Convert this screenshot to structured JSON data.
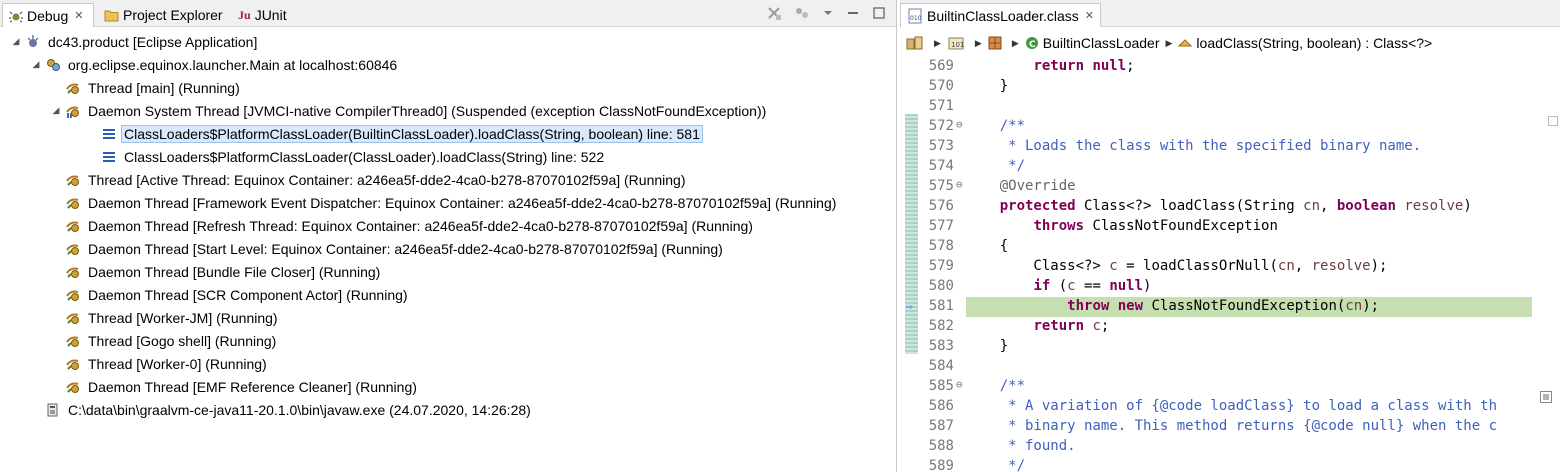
{
  "debug_view": {
    "tabs": [
      {
        "label": "Debug",
        "icon": "debug-icon",
        "active": true,
        "close": "✕"
      },
      {
        "label": "Project Explorer",
        "icon": "folder-icon",
        "active": false
      },
      {
        "label": "JUnit",
        "icon": "junit-icon",
        "active": false
      }
    ],
    "tree": [
      {
        "label": "dc43.product [Eclipse Application]",
        "icon": "launch-icon",
        "depth": 0,
        "expanded": true
      },
      {
        "label": "org.eclipse.equinox.launcher.Main at localhost:60846",
        "icon": "debug-target-icon",
        "depth": 1,
        "expanded": true
      },
      {
        "label": "Thread [main] (Running)",
        "icon": "thread-running-icon",
        "depth": 2
      },
      {
        "label": "Daemon System Thread [JVMCI-native CompilerThread0] (Suspended (exception ClassNotFoundException))",
        "icon": "thread-suspended-icon",
        "depth": 2,
        "expanded": true
      },
      {
        "label": "ClassLoaders$PlatformClassLoader(BuiltinClassLoader).loadClass(String, boolean) line: 581",
        "icon": "stack-frame-icon",
        "depth": 3,
        "selected": true
      },
      {
        "label": "ClassLoaders$PlatformClassLoader(ClassLoader).loadClass(String) line: 522",
        "icon": "stack-frame-icon",
        "depth": 3
      },
      {
        "label": "Thread [Active Thread: Equinox Container: a246ea5f-dde2-4ca0-b278-87070102f59a] (Running)",
        "icon": "thread-running-icon",
        "depth": 2
      },
      {
        "label": "Daemon Thread [Framework Event Dispatcher: Equinox Container: a246ea5f-dde2-4ca0-b278-87070102f59a] (Running)",
        "icon": "thread-running-icon",
        "depth": 2
      },
      {
        "label": "Daemon Thread [Refresh Thread: Equinox Container: a246ea5f-dde2-4ca0-b278-87070102f59a] (Running)",
        "icon": "thread-running-icon",
        "depth": 2
      },
      {
        "label": "Daemon Thread [Start Level: Equinox Container: a246ea5f-dde2-4ca0-b278-87070102f59a] (Running)",
        "icon": "thread-running-icon",
        "depth": 2
      },
      {
        "label": "Daemon Thread [Bundle File Closer] (Running)",
        "icon": "thread-running-icon",
        "depth": 2
      },
      {
        "label": "Daemon Thread [SCR Component Actor] (Running)",
        "icon": "thread-running-icon",
        "depth": 2
      },
      {
        "label": "Thread [Worker-JM] (Running)",
        "icon": "thread-running-icon",
        "depth": 2
      },
      {
        "label": "Thread [Gogo shell] (Running)",
        "icon": "thread-running-icon",
        "depth": 2
      },
      {
        "label": "Thread [Worker-0] (Running)",
        "icon": "thread-running-icon",
        "depth": 2
      },
      {
        "label": "Daemon Thread [EMF Reference Cleaner] (Running)",
        "icon": "thread-running-icon",
        "depth": 2
      },
      {
        "label": "C:\\data\\bin\\graalvm-ce-java11-20.1.0\\bin\\javaw.exe (24.07.2020, 14:26:28)",
        "icon": "process-icon",
        "depth": 1
      }
    ]
  },
  "editor": {
    "tab_label": "BuiltinClassLoader.class",
    "tab_close": "✕",
    "breadcrumb": {
      "class_name": "BuiltinClassLoader",
      "method_signature": "loadClass(String, boolean) : Class<?>"
    },
    "lines": [
      {
        "n": "569",
        "html": "        <span class=\"kw\">return</span> <span class=\"kw\">null</span>;"
      },
      {
        "n": "570",
        "html": "    }"
      },
      {
        "n": "571",
        "html": ""
      },
      {
        "n": "572",
        "fold": true,
        "html": "    <span class=\"cm\">/**</span>"
      },
      {
        "n": "573",
        "html": "<span class=\"cm\">     * Loads the class with the specified binary name.</span>"
      },
      {
        "n": "574",
        "html": "<span class=\"cm\">     */</span>"
      },
      {
        "n": "575",
        "fold": true,
        "html": "    <span class=\"an\">@Override</span>"
      },
      {
        "n": "576",
        "html": "    <span class=\"kw\">protected</span> Class&lt;?&gt; loadClass(String <span class=\"pv\">cn</span>, <span class=\"kw\">boolean</span> <span class=\"pv\">resolve</span>)"
      },
      {
        "n": "577",
        "html": "        <span class=\"kw\">throws</span> ClassNotFoundException"
      },
      {
        "n": "578",
        "html": "    {"
      },
      {
        "n": "579",
        "html": "        Class&lt;?&gt; <span class=\"pv\">c</span> = loadClassOrNull(<span class=\"pv\">cn</span>, <span class=\"pv\">resolve</span>);"
      },
      {
        "n": "580",
        "html": "        <span class=\"kw\">if</span> (<span class=\"pv\">c</span> == <span class=\"kw\">null</span>)"
      },
      {
        "n": "581",
        "current": true,
        "html": "            <span class=\"kw\">throw</span> <span class=\"kw\">new</span> ClassNotFoundException(<span class=\"pv\">cn</span>);"
      },
      {
        "n": "582",
        "html": "        <span class=\"kw\">return</span> <span class=\"pv\">c</span>;"
      },
      {
        "n": "583",
        "html": "    }"
      },
      {
        "n": "584",
        "html": ""
      },
      {
        "n": "585",
        "fold": true,
        "html": "    <span class=\"cm\">/**</span>"
      },
      {
        "n": "586",
        "html": "<span class=\"cm\">     * A variation of {@code loadClass} to load a class with th</span>"
      },
      {
        "n": "587",
        "html": "<span class=\"cm\">     * binary name. This method returns {@code null} when the c</span>"
      },
      {
        "n": "588",
        "html": "<span class=\"cm\">     * found.</span>"
      },
      {
        "n": "589",
        "html": "<span class=\"cm\">     */</span>"
      }
    ]
  },
  "colors": {
    "current_line": "#c6dfb0",
    "keyword": "#7f0055",
    "javadoc": "#3f5fbf",
    "selection": "#d9e8fb"
  }
}
